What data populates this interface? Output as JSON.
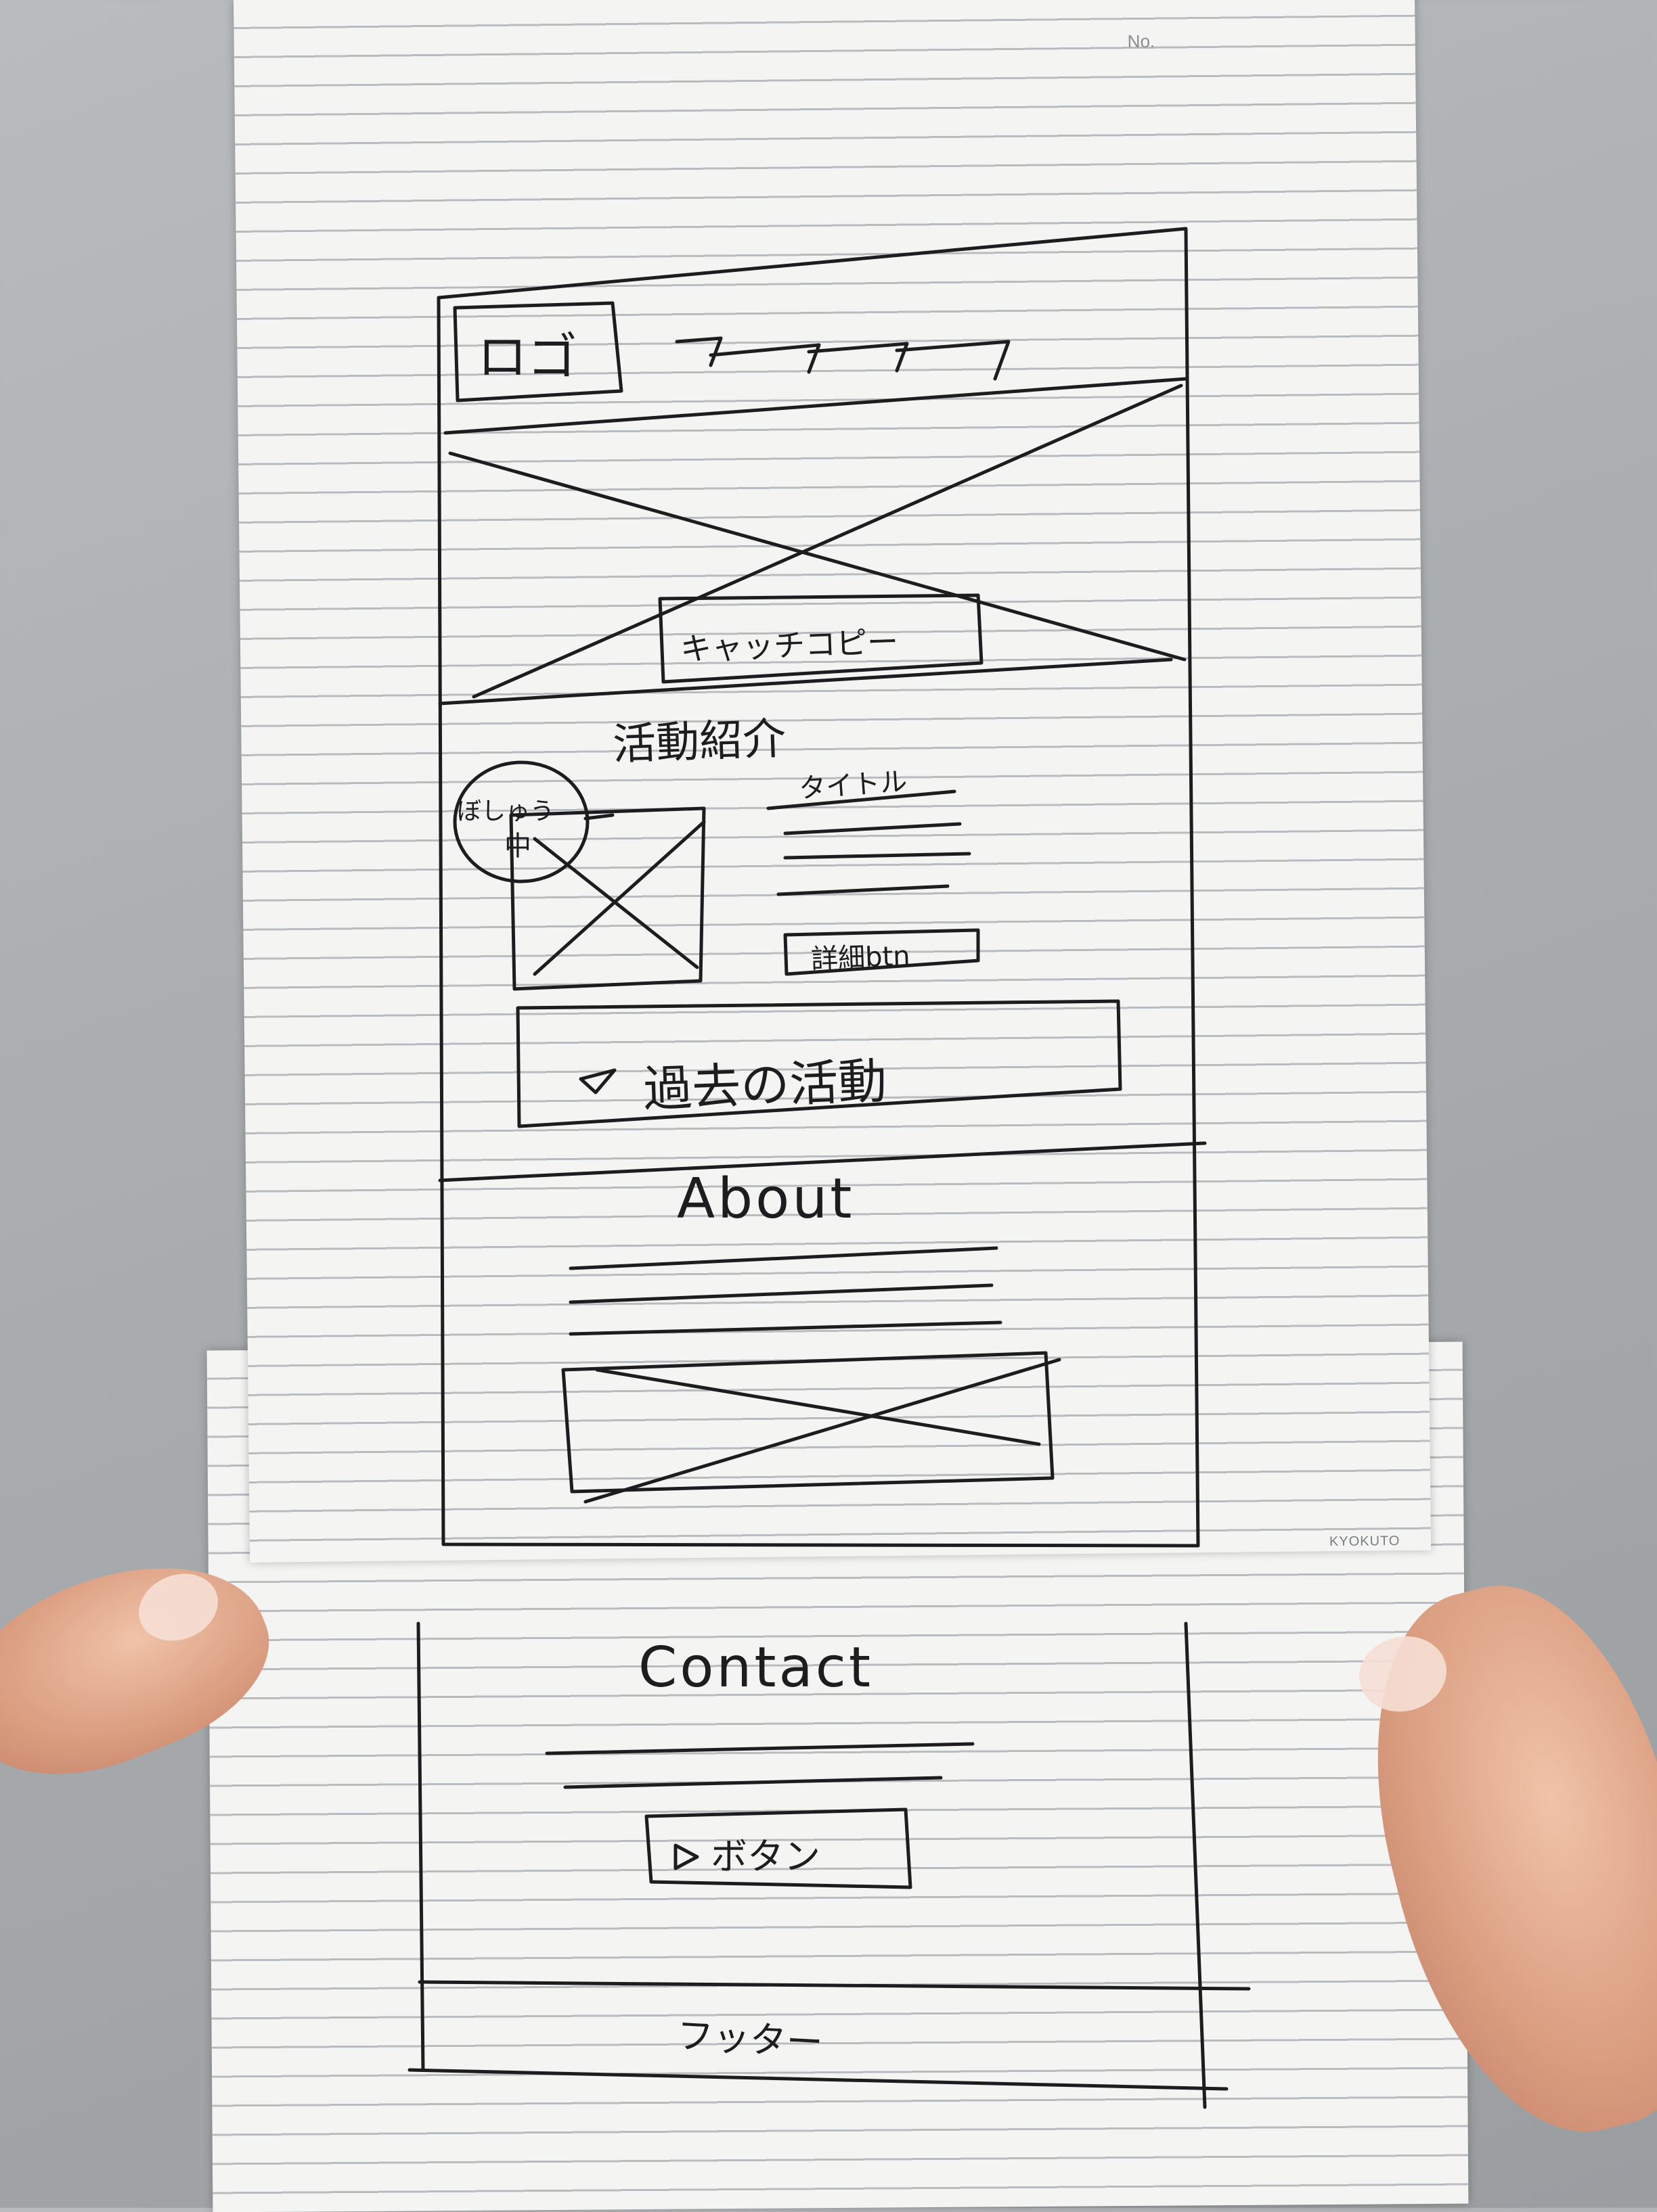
{
  "wireframe": {
    "header": {
      "logo_label": "ロゴ",
      "nav_items": [
        "—",
        "—",
        "—",
        "—"
      ]
    },
    "hero": {
      "catch_copy": "キャッチコピー"
    },
    "activities": {
      "heading": "活動紹介",
      "recruiting_badge_line1": "ぼしゅう",
      "recruiting_badge_line2": "中",
      "card_title": "タイトル",
      "detail_button": "詳細btn",
      "past_activities_button": "過去の活動"
    },
    "about": {
      "heading": "About"
    },
    "contact": {
      "heading": "Contact",
      "button_label": "ボタン"
    },
    "footer": {
      "label": "フッター"
    }
  },
  "paper": {
    "number_label": "No.",
    "brand": "KYOKUTO"
  }
}
